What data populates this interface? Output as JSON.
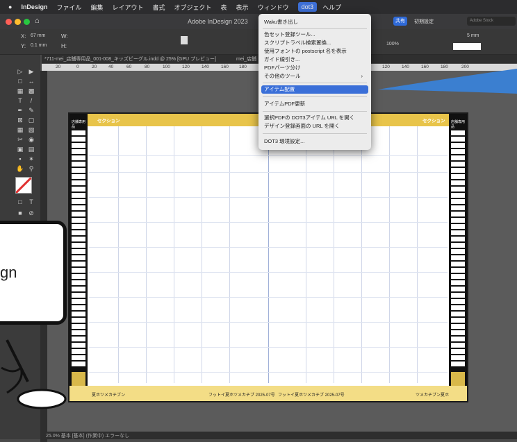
{
  "menubar": {
    "apple": "",
    "items": [
      "InDesign",
      "ファイル",
      "編集",
      "レイアウト",
      "書式",
      "オブジェクト",
      "表",
      "表示",
      "ウィンドウ",
      "dot3",
      "ヘルプ"
    ]
  },
  "titlebar": {
    "title": "Adobe InDesign 2023",
    "share_label": "共有",
    "workspace_label": "初期設定",
    "search_placeholder": "Adobe Stock"
  },
  "control": {
    "x": "67 mm",
    "y": "0.1 mm",
    "w": "",
    "h": "",
    "stroke": "5 mm",
    "zoom": "100%"
  },
  "doc_tab": {
    "label": "*711-mei_店舗専用品_001-008_キッズビーグル.indd @ 25% [GPU プレビュー]",
    "second": "mei_店舗"
  },
  "ruler": {
    "ticks": [
      "20",
      "0",
      "20",
      "40",
      "60",
      "80",
      "100",
      "120",
      "140",
      "160",
      "180",
      "120",
      "140",
      "160",
      "180",
      "200"
    ]
  },
  "dropdown": {
    "items": [
      {
        "label": "Waku書き出し"
      },
      {
        "label": "色セット登録ツール..."
      },
      {
        "label": "スクリプトラベル検索置換..."
      },
      {
        "label": "使用フォントの postscript 名を表示"
      },
      {
        "label": "ガイド線引き..."
      },
      {
        "label": "PDFパーツ分け"
      },
      {
        "label": "その他のツール"
      },
      {
        "label": "アイテム配置"
      },
      {
        "label": "アイテムPDF更新"
      },
      {
        "label": "選択PDFの DOT3アイテム URL を開く"
      },
      {
        "label": "デザイン登録画面の URL を開く"
      },
      {
        "label": "DOT3 環境設定..."
      }
    ],
    "submenu_arrow": "›"
  },
  "spread": {
    "section_left": "セクション",
    "section_right": "セクション",
    "footer_left": "夏ホツメカチブン",
    "footer_center1": "フットイ夏ホツメカチブ  2025-07号",
    "footer_center2": "フットイ夏ホツメカチブ  2025-07号",
    "footer_right": "ツメカチブン夏ホ",
    "corner_label": "店舗専用品"
  },
  "monitor": {
    "text": "gn"
  },
  "statusbar": {
    "text": "25.0%  基本  [基本] (作業中)  エラーなし"
  },
  "colors": {
    "highlight": "#3a6fd8",
    "arrow": "#3b7fd0",
    "gold": "#e8c44a"
  }
}
